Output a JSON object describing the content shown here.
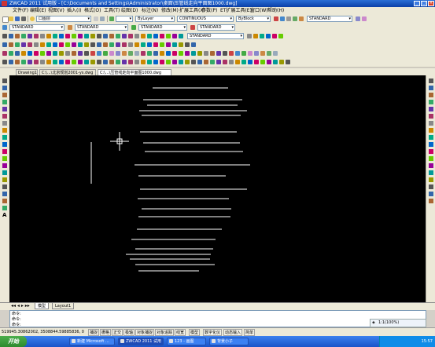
{
  "window": {
    "title": "ZWCAD 2011 试用版 - [C:\\Documents and Settings\\Administrator\\桌面\\压管线走向平面图1000.dwg]",
    "controls": {
      "min": "_",
      "max": "□",
      "close": "×"
    }
  },
  "menu": [
    "文件(F)",
    "编辑(E)",
    "视图(V)",
    "插入(I)",
    "格式(O)",
    "工具(T)",
    "绘图(D)",
    "标注(N)",
    "修改(M)",
    "扩展工具(X)",
    "参数(P)",
    "ET扩展工具(E)",
    "窗口(W)",
    "帮助(H)"
  ],
  "toolbars": {
    "layer_value": "口图层",
    "color_value": "ByLayer",
    "linetype_value": "CONTINUOUS",
    "lineweight_value": "ByBlock",
    "style_value_1": "STANDARD",
    "text_style": "STANDARD",
    "dim_style": "STANDARD",
    "table_style": "STANDARD",
    "mleader_style": "STANDARD",
    "row4_style": "STANDARD"
  },
  "doc_tabs": [
    "Drawing1",
    "C:\\...\\北京规划2001-ys.dwg",
    "C:\\...\\压管线走向平面图1000.dwg"
  ],
  "layout_tabs": [
    "模型",
    "Layout1"
  ],
  "command": {
    "line1": "命令:",
    "line2": "命令:",
    "prompt": "命令:"
  },
  "mini_panel": "1:1(100%)",
  "status": {
    "coords": "519945.30862002, 3508844.59885836, 0",
    "buttons": [
      "捕捉",
      "栅格",
      "正交",
      "极轴",
      "对象捕捉",
      "对象追踪",
      "线宽",
      "模型",
      "数字化仪",
      "动态输入",
      "简单"
    ]
  },
  "taskbar": {
    "start_label": "开始",
    "items": [
      "新建 Microsoft ...",
      "ZWCAD 2011 试用",
      "123 - 画图",
      "背景小子"
    ],
    "clock": "15:57"
  },
  "colors": {
    "canvas": "#000000",
    "line": "#ffffff",
    "accent": "#0a3fa8"
  },
  "drawing": {
    "description_lines": 25
  }
}
